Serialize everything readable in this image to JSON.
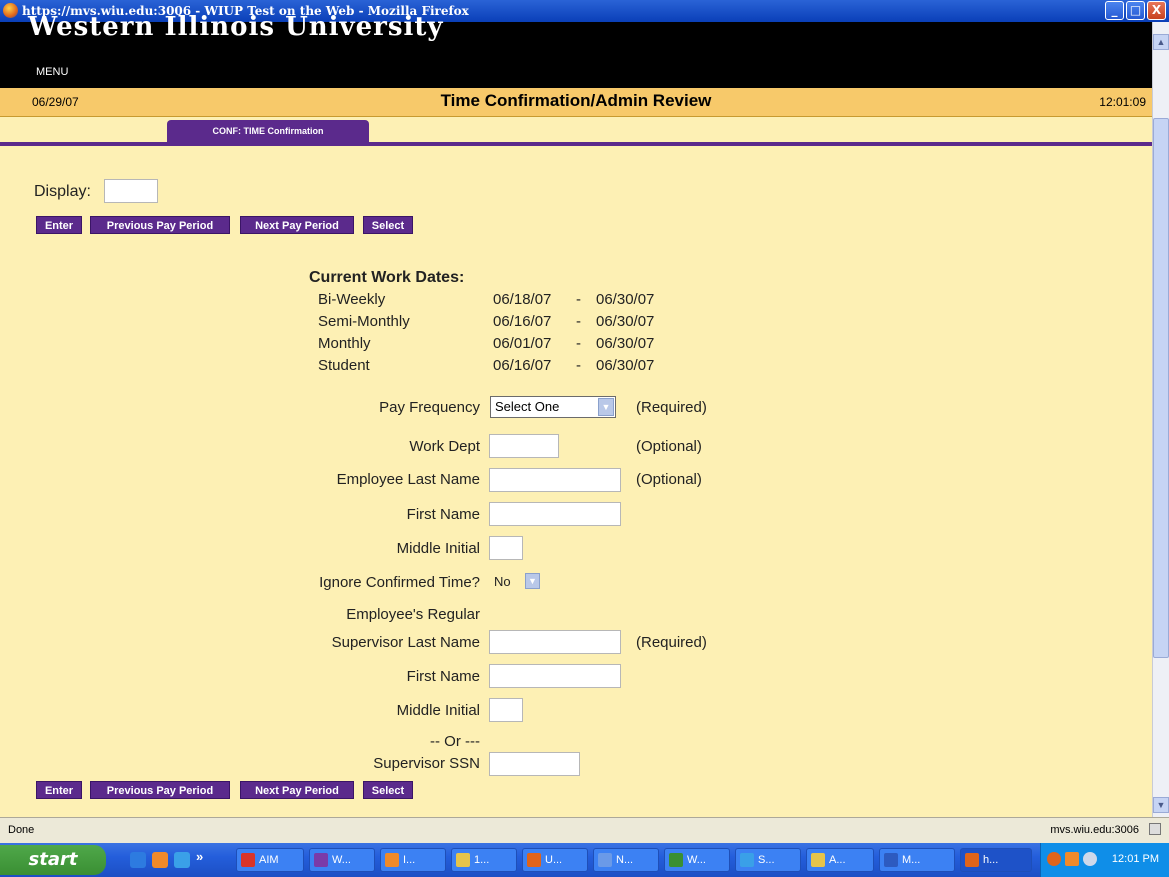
{
  "window": {
    "title": "https://mvs.wiu.edu:3006 - WIUP Test on the Web - Mozilla Firefox",
    "minimize": "_",
    "maximize": "□",
    "close": "X"
  },
  "header": {
    "university": "Western Illinois University",
    "menu_label": "MENU"
  },
  "datebar": {
    "date": "06/29/07",
    "title": "Time Confirmation/Admin Review",
    "time": "12:01:09"
  },
  "tab": {
    "label": "CONF: TIME Confirmation"
  },
  "display": {
    "label": "Display:",
    "value": ""
  },
  "buttons": {
    "enter": "Enter",
    "previous": "Previous Pay Period",
    "next": "Next Pay Period",
    "select": "Select"
  },
  "work_dates": {
    "heading": "Current Work Dates:",
    "rows": [
      {
        "name": "Bi-Weekly",
        "start": "06/18/07",
        "sep": "-",
        "end": "06/30/07"
      },
      {
        "name": "Semi-Monthly",
        "start": "06/16/07",
        "sep": "-",
        "end": "06/30/07"
      },
      {
        "name": "Monthly",
        "start": "06/01/07",
        "sep": "-",
        "end": "06/30/07"
      },
      {
        "name": "Student",
        "start": "06/16/07",
        "sep": "-",
        "end": "06/30/07"
      }
    ]
  },
  "form": {
    "pay_frequency": {
      "label": "Pay Frequency",
      "value": "Select One",
      "note": "(Required)"
    },
    "work_dept": {
      "label": "Work Dept",
      "note": "(Optional)"
    },
    "emp_last": {
      "label": "Employee Last Name",
      "note": "(Optional)"
    },
    "emp_first": {
      "label": "First Name"
    },
    "emp_mi": {
      "label": "Middle Initial"
    },
    "ignore_confirmed": {
      "label": "Ignore Confirmed Time?",
      "value": "No"
    },
    "employees_regular": {
      "label": "Employee's Regular"
    },
    "sup_last": {
      "label": "Supervisor Last Name",
      "note": "(Required)"
    },
    "sup_first": {
      "label": "First Name"
    },
    "sup_mi": {
      "label": "Middle Initial"
    },
    "or_text": "-- Or ---",
    "sup_ssn": {
      "label": "Supervisor SSN"
    }
  },
  "status": {
    "text": "Done",
    "host": "mvs.wiu.edu:3006"
  },
  "taskbar": {
    "start": "start",
    "chevron": "»",
    "items": [
      "AIM",
      "W...",
      "I...",
      "1...",
      "U...",
      "N...",
      "W...",
      "S...",
      "A...",
      "M...",
      "h..."
    ],
    "clock": "12:01 PM"
  }
}
